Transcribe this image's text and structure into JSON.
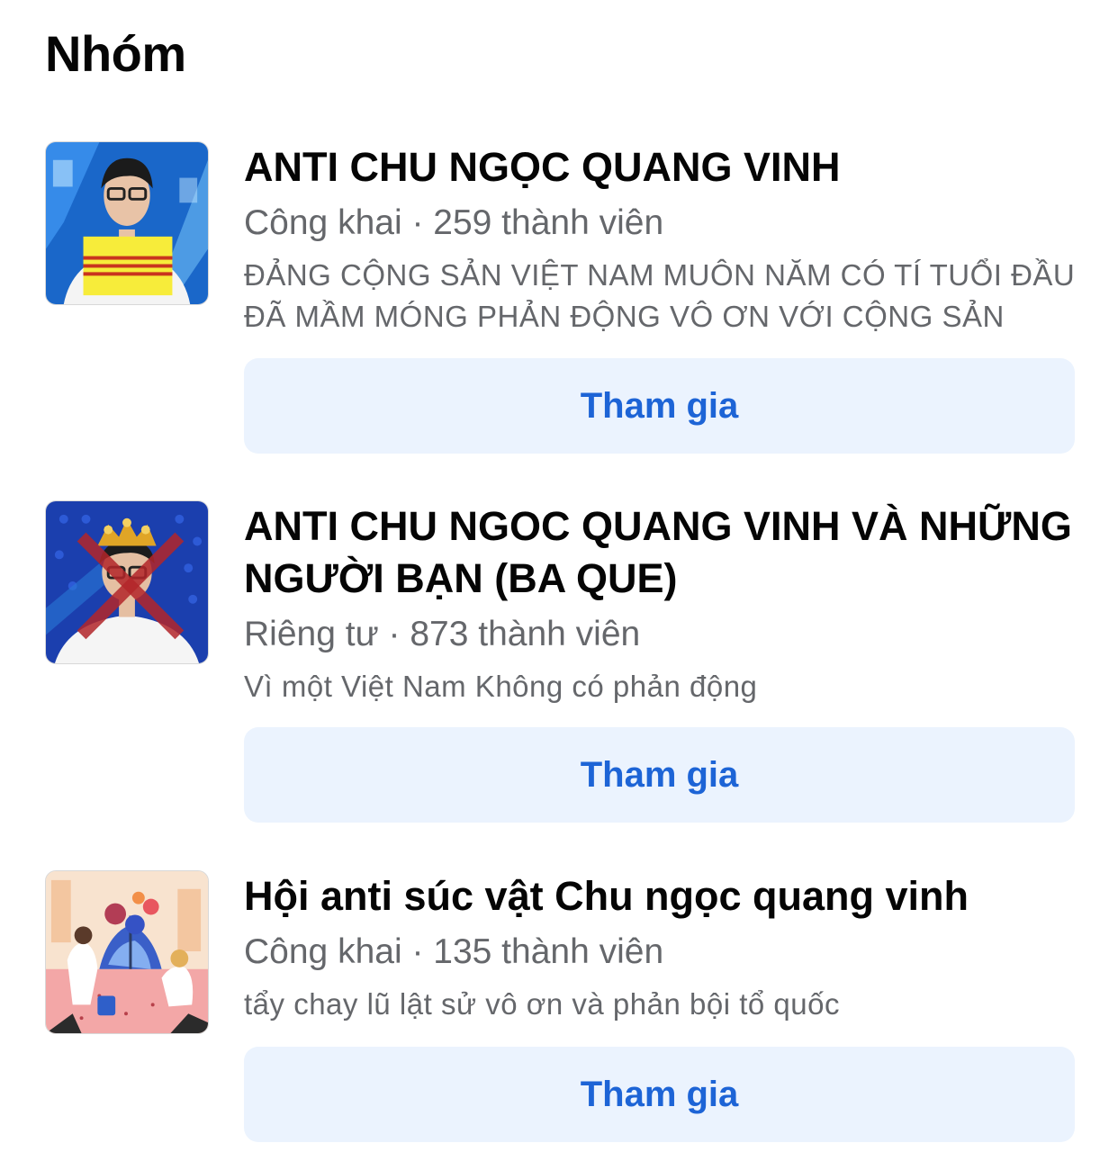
{
  "section": {
    "title": "Nhóm"
  },
  "groups": [
    {
      "name": "ANTI CHU NGỌC QUANG VINH",
      "meta": "Công khai · 259 thành viên",
      "description": "ĐẢNG CỘNG SẢN VIỆT NAM MUÔN NĂM CÓ TÍ TUỔI ĐẦU ĐÃ MẦM MÓNG PHẢN ĐỘNG VÔ ƠN VỚI CỘNG SẢN",
      "join_label": "Tham gia"
    },
    {
      "name": "ANTI CHU NGOC QUANG VINH VÀ NHỮNG NGƯỜI BẠN (BA QUE)",
      "meta": "Riêng tư · 873 thành viên",
      "description": "Vì một Việt Nam Không có phản động",
      "join_label": "Tham gia"
    },
    {
      "name": "Hội anti súc vật Chu ngọc quang vinh",
      "meta": "Công khai · 135 thành viên",
      "description": "tẩy chay lũ lật sử vô ơn và phản bội tổ quốc",
      "join_label": "Tham gia"
    }
  ],
  "colors": {
    "button_bg": "#ebf3fe",
    "button_text": "#1d64d6",
    "secondary_text": "#65676b"
  },
  "icons": {
    "group1": "group-photo-portrait-yellow-flag",
    "group2": "group-photo-portrait-crossed-out",
    "group3": "group-illustration-gardening"
  }
}
